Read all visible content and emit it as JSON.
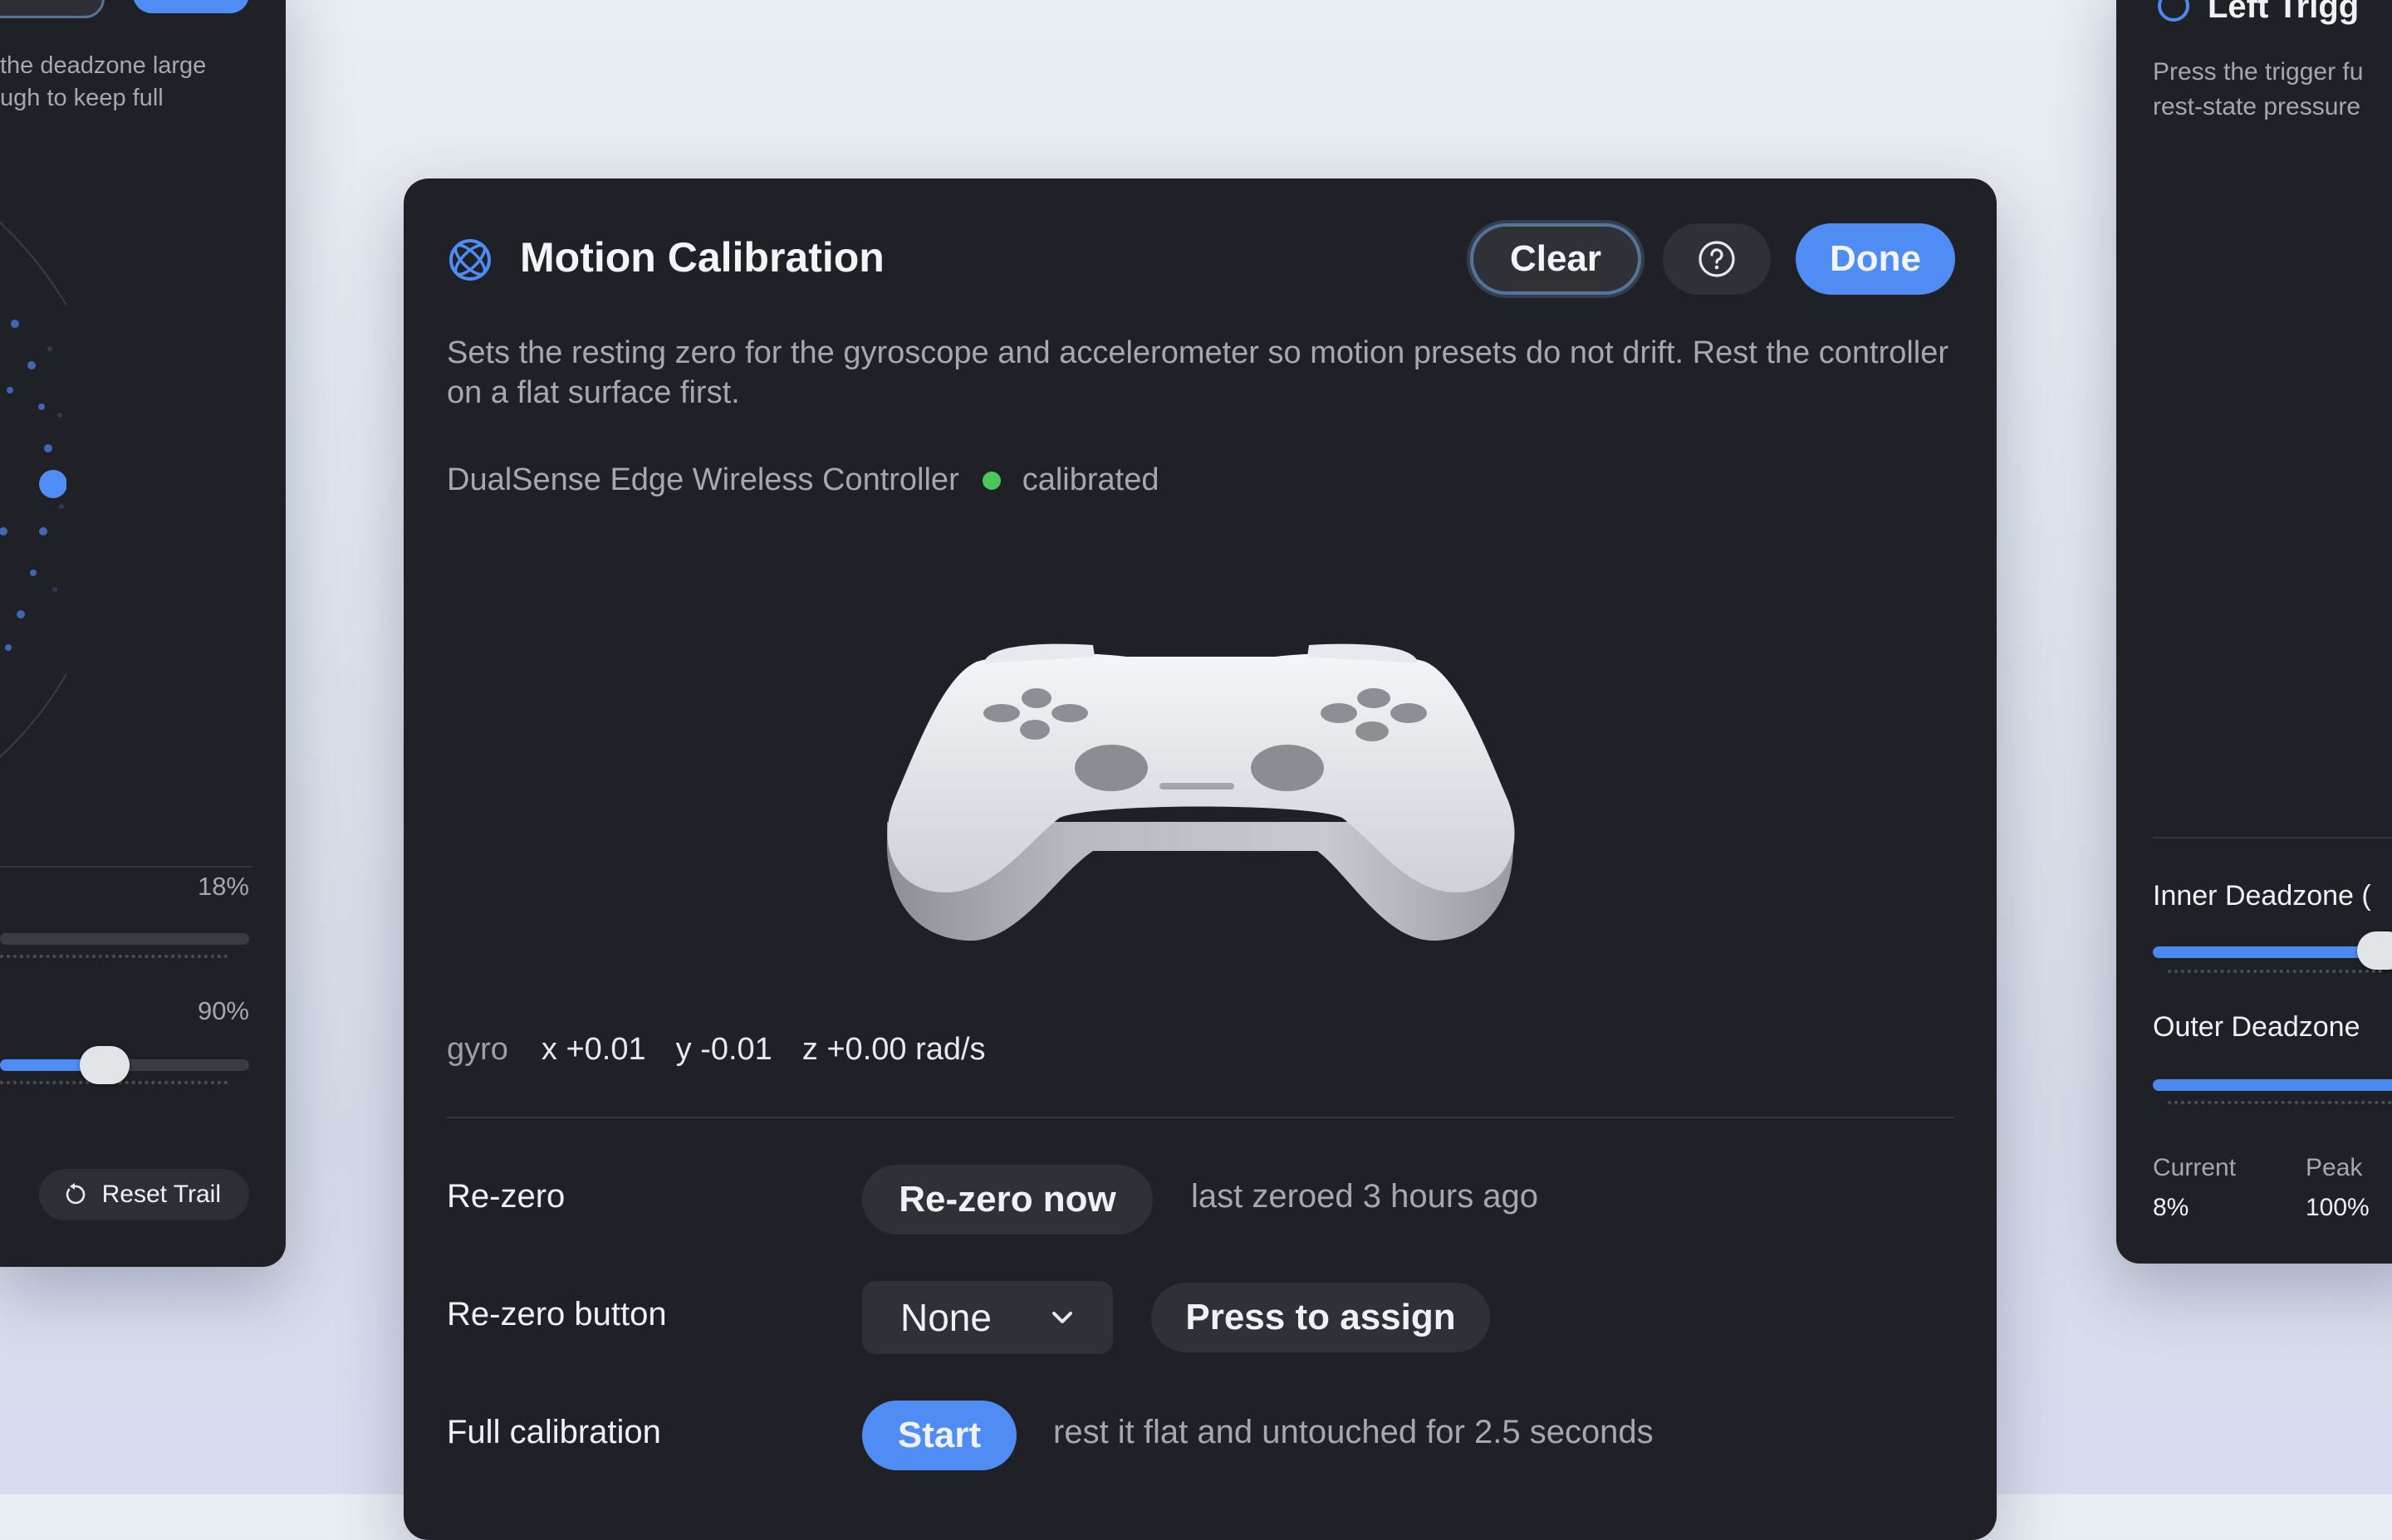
{
  "left_panel": {
    "description_lines": [
      "the deadzone large",
      "ugh to keep full"
    ],
    "inner_value": "18%",
    "outer_value": "90%",
    "outer_level": 0.42,
    "reset_trail_label": "Reset Trail",
    "reset_icon": "reset-arrow-icon"
  },
  "dialog": {
    "title": "Motion Calibration",
    "title_icon": "gyroscope-icon",
    "clear_label": "Clear",
    "help_icon": "question-circle-icon",
    "done_label": "Done",
    "description": "Sets the resting zero for the gyroscope and accelerometer so motion presets do not drift. Rest the controller on a flat surface first.",
    "device_name": "DualSense Edge Wireless Controller",
    "device_status": "calibrated",
    "status_color": "#4cc85a",
    "gyro": {
      "label": "gyro",
      "x": "x +0.01",
      "y": "y -0.01",
      "z": "z +0.00 rad/s"
    },
    "rezero": {
      "label": "Re-zero",
      "button_label": "Re-zero now",
      "hint": "last zeroed 3 hours ago"
    },
    "rezero_button": {
      "label": "Re-zero button",
      "selected": "None",
      "assign_label": "Press to assign"
    },
    "full_calibration": {
      "label": "Full calibration",
      "button_label": "Start",
      "hint": "rest it flat and untouched for 2.5 seconds"
    },
    "accent_color": "#4f8cf3"
  },
  "right_panel": {
    "title": "Left Trigg",
    "description_lines": [
      "Press the trigger fu",
      "rest-state pressure"
    ],
    "inner_label": "Inner Deadzone (",
    "outer_label": "Outer Deadzone",
    "current_label": "Current",
    "current_value": "8%",
    "peak_label": "Peak",
    "peak_value": "100%"
  }
}
